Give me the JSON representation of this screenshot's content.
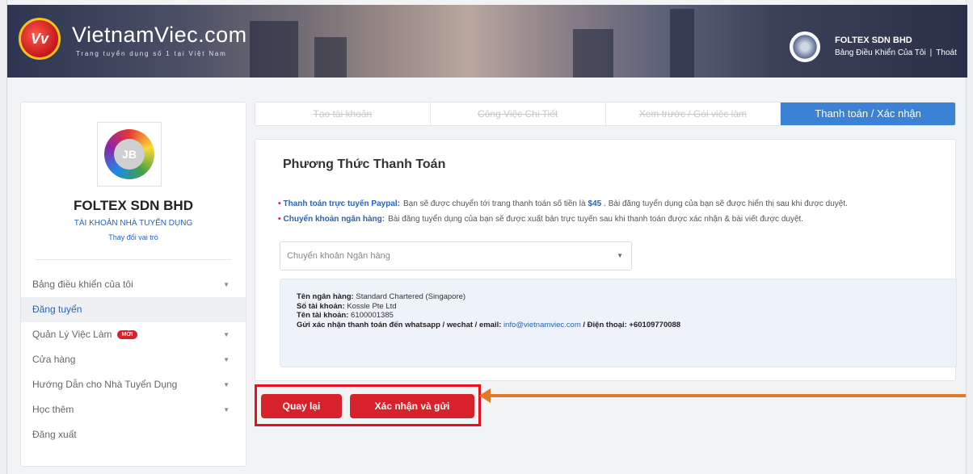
{
  "header": {
    "logo_mark": "Vv",
    "logo_text": "VietnamViec.com",
    "tagline": "Trang tuyển dụng số 1 tại Việt Nam",
    "company": "FOLTEX SDN BHD",
    "dashboard_link": "Bảng Điều Khiển Của Tôi",
    "separator": "|",
    "logout_link": "Thoát"
  },
  "sidebar": {
    "logo_initials": "JB",
    "company": "FOLTEX SDN BHD",
    "role": "TÀI KHOẢN NHÀ TUYỂN DỤNG",
    "switch_role": "Thay đổi vai trò",
    "items": [
      {
        "label": "Bảng điều khiển của tôi",
        "caret": "▼"
      },
      {
        "label": "Đăng tuyển",
        "active": true
      },
      {
        "label": "Quản Lý Việc Làm",
        "badge": "MỚI",
        "caret": "▼"
      },
      {
        "label": "Cửa hàng",
        "caret": "▼"
      },
      {
        "label": "Hướng Dẫn cho Nhà Tuyển Dụng",
        "caret": "▼"
      },
      {
        "label": "Học thêm",
        "caret": "▼"
      },
      {
        "label": "Đăng xuất"
      }
    ]
  },
  "steps": [
    "Tạo tài khoản",
    "Công Việc Chi Tiết",
    "Xem trước / Gói việc làm",
    "Thanh toán / Xác nhận"
  ],
  "payment": {
    "title": "Phương Thức Thanh Toán",
    "notes": [
      {
        "label": "Thanh toán trực tuyến Paypal:",
        "text_before": "Bạn sẽ được chuyển tới trang thanh toán số tiền là",
        "price": "$45",
        "text_after": ". Bài đăng tuyển dụng của bạn sẽ được hiển thị sau khi được duyệt."
      },
      {
        "label": "Chuyển khoản ngân hàng:",
        "text_before": "Bài đăng tuyển dụng của bạn sẽ được xuất bản trực tuyến sau khi thanh toán được xác nhận & bài viết được duyệt.",
        "price": "",
        "text_after": ""
      }
    ],
    "method_selected": "Chuyển khoản Ngân hàng",
    "bank": {
      "bank_name_label": "Tên ngân hàng:",
      "bank_name": "Standard Chartered (Singapore)",
      "account_no_label": "Số tài khoản:",
      "account_no": "Kossle Pte Ltd",
      "account_name_label": "Tên tài khoản:",
      "account_name": "6100001385",
      "confirm_label": "Gửi xác nhận thanh toán đến whatsapp / wechat / email:",
      "email": "info@vietnamviec.com",
      "phone_label": "/ Điện thoại:",
      "phone": "+60109770088"
    }
  },
  "buttons": {
    "back": "Quay lại",
    "submit": "Xác nhận và gửi"
  },
  "colors": {
    "accent_red": "#d8222b",
    "accent_blue": "#3b82d6",
    "annotation_arrow": "#e07a2a",
    "annotation_box": "#e8101c"
  }
}
